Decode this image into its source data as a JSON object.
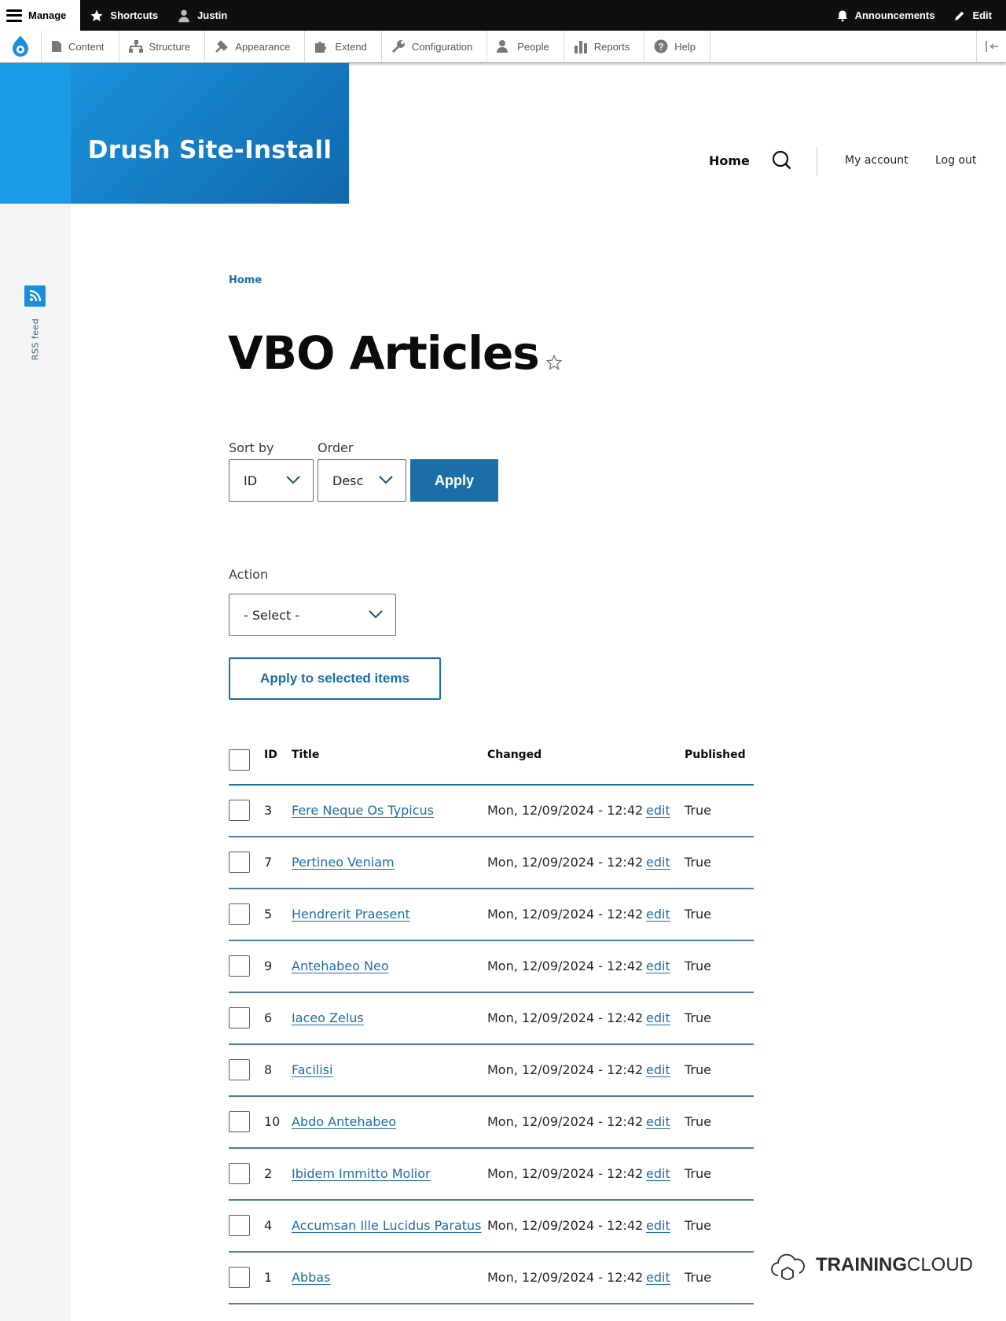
{
  "toolbar": {
    "manage": "Manage",
    "shortcuts": "Shortcuts",
    "user": "Justin",
    "announcements": "Announcements",
    "edit": "Edit"
  },
  "tray": {
    "items": [
      "Content",
      "Structure",
      "Appearance",
      "Extend",
      "Configuration",
      "People",
      "Reports",
      "Help"
    ]
  },
  "site": {
    "name": "Drush Site-Install"
  },
  "nav": {
    "home": "Home",
    "my_account": "My account",
    "log_out": "Log out"
  },
  "sidebar": {
    "rss_label": "RSS feed"
  },
  "breadcrumb": {
    "home": "Home"
  },
  "page": {
    "title": "VBO Articles"
  },
  "filters": {
    "sort_by_label": "Sort by",
    "sort_by_value": "ID",
    "order_label": "Order",
    "order_value": "Desc",
    "apply": "Apply"
  },
  "bulk": {
    "action_label": "Action",
    "action_value": "- Select -",
    "apply_selected": "Apply to selected items"
  },
  "table": {
    "headers": {
      "id": "ID",
      "title": "Title",
      "changed": "Changed",
      "published": "Published"
    },
    "rows": [
      {
        "id": "3",
        "title": "Fere Neque Os Typicus",
        "changed": "Mon, 12/09/2024 - 12:42",
        "edit": "edit",
        "published": "True"
      },
      {
        "id": "7",
        "title": "Pertineo Veniam",
        "changed": "Mon, 12/09/2024 - 12:42",
        "edit": "edit",
        "published": "True"
      },
      {
        "id": "5",
        "title": "Hendrerit Praesent",
        "changed": "Mon, 12/09/2024 - 12:42",
        "edit": "edit",
        "published": "True"
      },
      {
        "id": "9",
        "title": "Antehabeo Neo",
        "changed": "Mon, 12/09/2024 - 12:42",
        "edit": "edit",
        "published": "True"
      },
      {
        "id": "6",
        "title": "Iaceo Zelus",
        "changed": "Mon, 12/09/2024 - 12:42",
        "edit": "edit",
        "published": "True"
      },
      {
        "id": "8",
        "title": "Facilisi",
        "changed": "Mon, 12/09/2024 - 12:42",
        "edit": "edit",
        "published": "True"
      },
      {
        "id": "10",
        "title": "Abdo Antehabeo",
        "changed": "Mon, 12/09/2024 - 12:42",
        "edit": "edit",
        "published": "True"
      },
      {
        "id": "2",
        "title": "Ibidem Immitto Molior",
        "changed": "Mon, 12/09/2024 - 12:42",
        "edit": "edit",
        "published": "True"
      },
      {
        "id": "4",
        "title": "Accumsan Ille Lucidus Paratus",
        "changed": "Mon, 12/09/2024 - 12:42",
        "edit": "edit",
        "published": "True"
      },
      {
        "id": "1",
        "title": "Abbas",
        "changed": "Mon, 12/09/2024 - 12:42",
        "edit": "edit",
        "published": "True"
      }
    ]
  },
  "watermark": {
    "bold": "TRAINING",
    "rest": "CLOUD"
  },
  "colors": {
    "accent": "#1c6ea6",
    "brand_blue": "#1a9be6",
    "toolbar_bg": "#0f0f0f"
  }
}
